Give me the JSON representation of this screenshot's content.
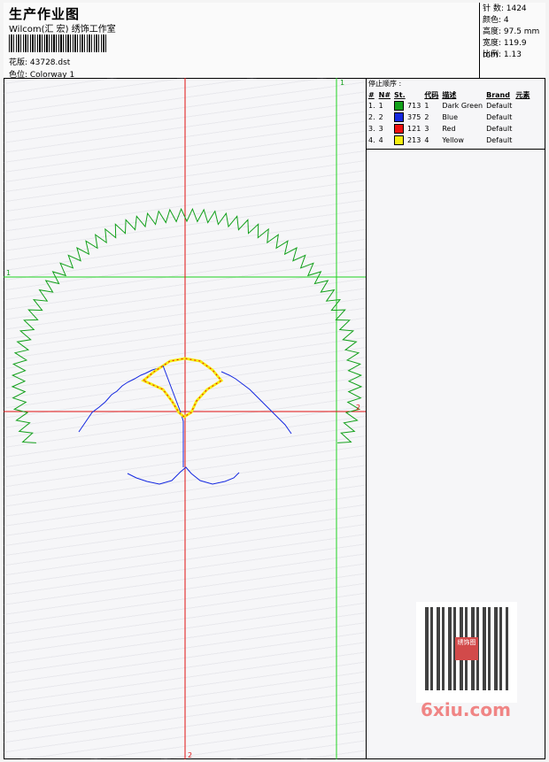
{
  "header": {
    "title": "生产作业图",
    "company": "Wilcom(汇 宏) 绣饰工作室",
    "design_label": "花版: 43728.dst",
    "colorway_label": "色位: Colorway 1"
  },
  "stats": {
    "stitches": "针 数: 1424",
    "colors": "颜色: 4",
    "height": "高度: 97.5 mm",
    "width": "宽度: 119.9 mm",
    "scale": "比例: 1.13"
  },
  "stop_sequence": {
    "title": "停止顺序 :",
    "headers": [
      "#",
      "N#",
      "St.",
      "代码",
      "描述",
      "Brand",
      "元素"
    ],
    "rows": [
      {
        "num": "1.",
        "n": "1",
        "color": "#12a01a",
        "st": "713",
        "code": "1",
        "desc": "Dark Green",
        "brand": "Default"
      },
      {
        "num": "2.",
        "n": "2",
        "color": "#1428e0",
        "st": "375",
        "code": "2",
        "desc": "Blue",
        "brand": "Default"
      },
      {
        "num": "3.",
        "n": "3",
        "color": "#ee1010",
        "st": "121",
        "code": "3",
        "desc": "Red",
        "brand": "Default"
      },
      {
        "num": "4.",
        "n": "4",
        "color": "#f5ee10",
        "st": "213",
        "code": "4",
        "desc": "Yellow",
        "brand": "Default"
      }
    ]
  },
  "axis_labels": {
    "green_top": "1",
    "green_left": "1",
    "red_bottom": "2",
    "red_right": "2"
  },
  "watermark": {
    "text": "6xiu.com",
    "stamp": "绣饰图"
  },
  "colors": {
    "green": "#1fd31f",
    "red": "#e01010",
    "dark_green": "#12a01a",
    "blue": "#1428e0",
    "yellow": "#f5ee10"
  }
}
